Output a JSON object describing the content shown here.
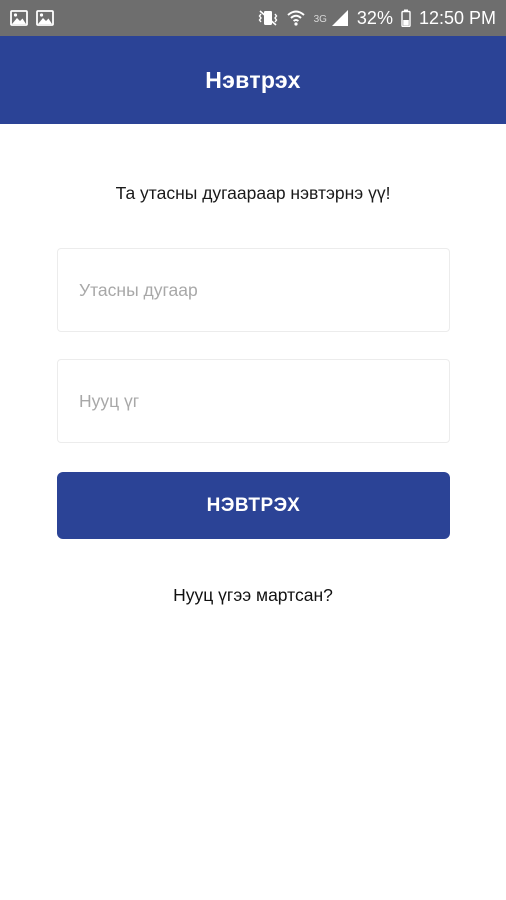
{
  "status_bar": {
    "icons": [
      "image-notification-icon",
      "image-notification-icon",
      "vibrate-icon",
      "wifi-icon",
      "signal-icon",
      "battery-icon"
    ],
    "network_label": "3G",
    "battery": "32%",
    "time": "12:50 PM"
  },
  "app_bar": {
    "title": "Нэвтрэх"
  },
  "login_form": {
    "subtitle": "Та утасны дугаараар нэвтэрнэ үү!",
    "phone_placeholder": "Утасны дугаар",
    "password_placeholder": "Нууц үг",
    "submit_label": "НЭВТРЭХ",
    "forgot_label": "Нууц үгээ мартсан?"
  },
  "colors": {
    "primary": "#2b4396",
    "status_bar": "#6e6e6e",
    "background": "#ffffff"
  }
}
